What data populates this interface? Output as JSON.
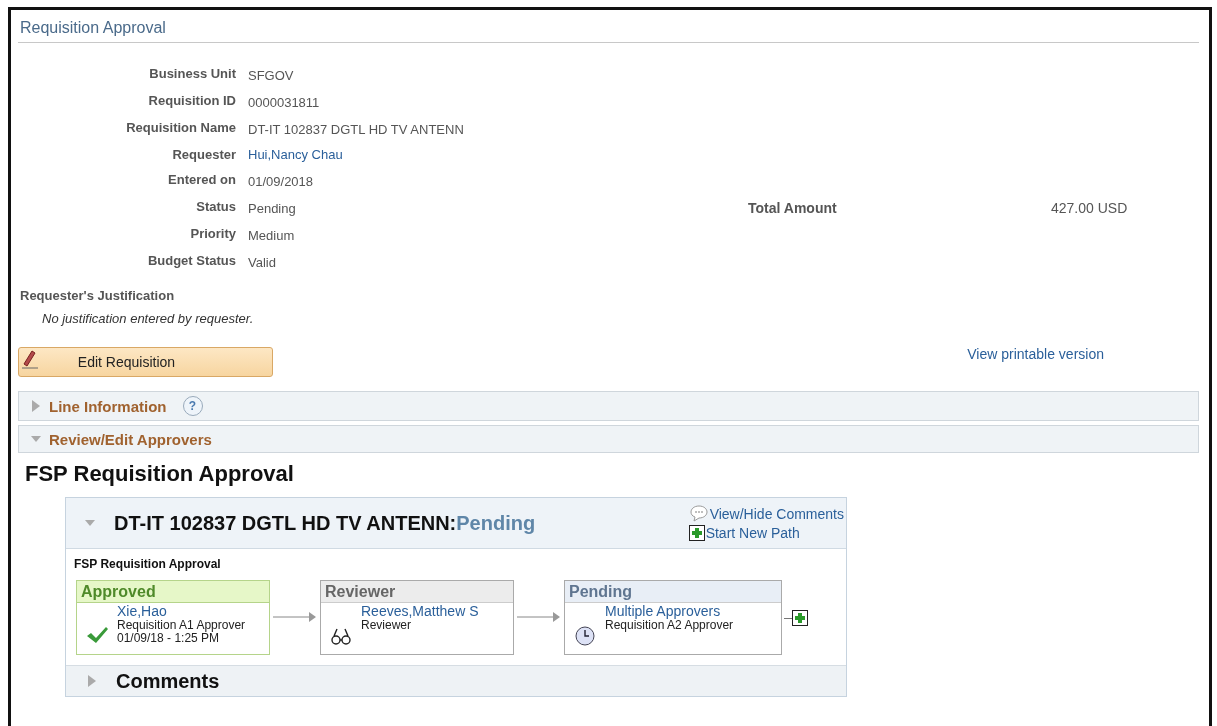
{
  "page_title": "Requisition Approval",
  "fields": [
    {
      "label": "Business Unit",
      "value": "SFGOV",
      "kind": "text"
    },
    {
      "label": "Requisition ID",
      "value": "0000031811",
      "kind": "text"
    },
    {
      "label": "Requisition Name",
      "value": "DT-IT 102837 DGTL HD TV ANTENN",
      "kind": "text"
    },
    {
      "label": "Requester",
      "value": "Hui,Nancy Chau",
      "kind": "link"
    },
    {
      "label": "Entered on",
      "value": "01/09/2018",
      "kind": "text"
    },
    {
      "label": "Status",
      "value": "Pending",
      "kind": "text"
    },
    {
      "label": "Priority",
      "value": "Medium",
      "kind": "text"
    },
    {
      "label": "Budget Status",
      "value": "Valid",
      "kind": "text"
    }
  ],
  "total_amount": {
    "label": "Total Amount",
    "value": "427.00 USD"
  },
  "justification": {
    "label": "Requester's Justification",
    "text": "No justification entered by requester."
  },
  "edit_button": "Edit Requisition",
  "printable_link": "View printable version",
  "sections": [
    {
      "title": "Line Information",
      "expanded": false,
      "help": "?"
    },
    {
      "title": "Review/Edit Approvers",
      "expanded": true
    }
  ],
  "approval": {
    "heading": "FSP Requisition Approval",
    "item": "DT-IT 102837 DGTL HD TV ANTENN:",
    "status": "Pending",
    "expanded": true,
    "links": [
      "View/Hide Comments",
      "Start New Path"
    ],
    "path_name": "FSP Requisition Approval",
    "steps": [
      {
        "kind": "approved",
        "header": "Approved",
        "name": "Xie,Hao",
        "role": "Requisition A1 Approver",
        "date": "01/09/18 - 1:25 PM"
      },
      {
        "kind": "reviewer",
        "header": "Reviewer",
        "name": "Reeves,Matthew S",
        "role": "Reviewer"
      },
      {
        "kind": "pending",
        "header": "Pending",
        "name": "Multiple Approvers",
        "role": "Requisition A2 Approver"
      }
    ],
    "comments": {
      "title": "Comments",
      "expanded": false
    }
  }
}
